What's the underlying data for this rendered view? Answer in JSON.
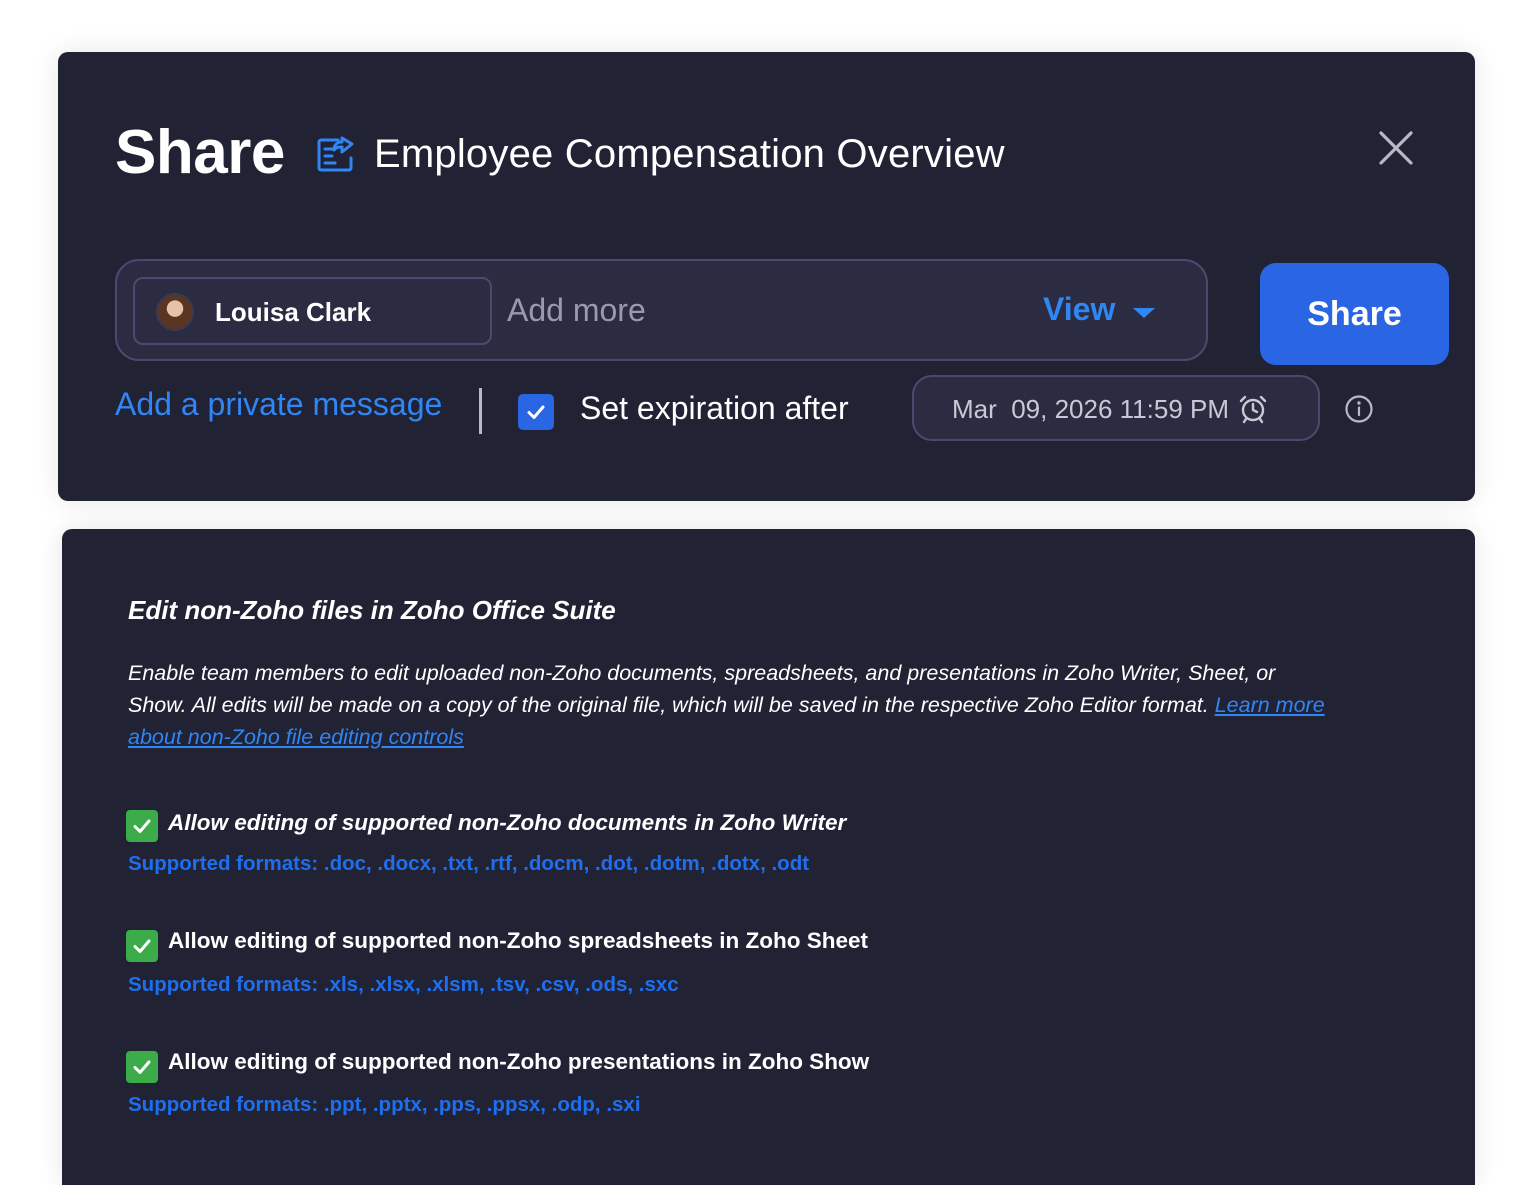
{
  "share_dialog": {
    "title": "Share",
    "document_icon": "document-share-icon",
    "document_name": "Employee Compensation Overview",
    "close_icon": "close-icon",
    "recipient": {
      "name": "Louisa Clark",
      "avatar_icon": "avatar"
    },
    "add_more_placeholder": "Add more",
    "permission": {
      "selected": "View",
      "caret_icon": "caret-down-icon"
    },
    "share_button": "Share",
    "private_message_link": "Add a private message",
    "expiration": {
      "checked": true,
      "label": "Set expiration after",
      "date_text": "Mar  09, 2026 11:59 PM",
      "alarm_icon": "alarm-clock-icon"
    },
    "info_icon": "info-icon"
  },
  "settings": {
    "title": "Edit non-Zoho files in Zoho Office Suite",
    "description": "Enable team members to edit uploaded non-Zoho documents, spreadsheets, and presentations in Zoho Writer, Sheet, or Show. All edits will be made on a copy of the original file, which will be saved in the respective Zoho Editor format. ",
    "learn_more_link": "Learn more about non-Zoho file editing controls",
    "options": [
      {
        "checked": true,
        "label": "Allow editing of supported non-Zoho documents in Zoho Writer",
        "formats": "Supported formats: .doc, .docx, .txt, .rtf, .docm, .dot, .dotm, .dotx, .odt"
      },
      {
        "checked": true,
        "label": "Allow editing of supported non-Zoho spreadsheets in Zoho Sheet",
        "formats": "Supported formats: .xls, .xlsx, .xlsm, .tsv, .csv, .ods, .sxc"
      },
      {
        "checked": true,
        "label": "Allow editing of supported non-Zoho presentations in Zoho Show",
        "formats": "Supported formats: .ppt, .pptx, .pps, .ppsx, .odp, .sxi"
      }
    ]
  },
  "colors": {
    "panel_bg": "#222235",
    "accent_blue": "#2f86f5",
    "button_blue": "#2a66e3",
    "checkbox_green": "#3cab4a"
  }
}
